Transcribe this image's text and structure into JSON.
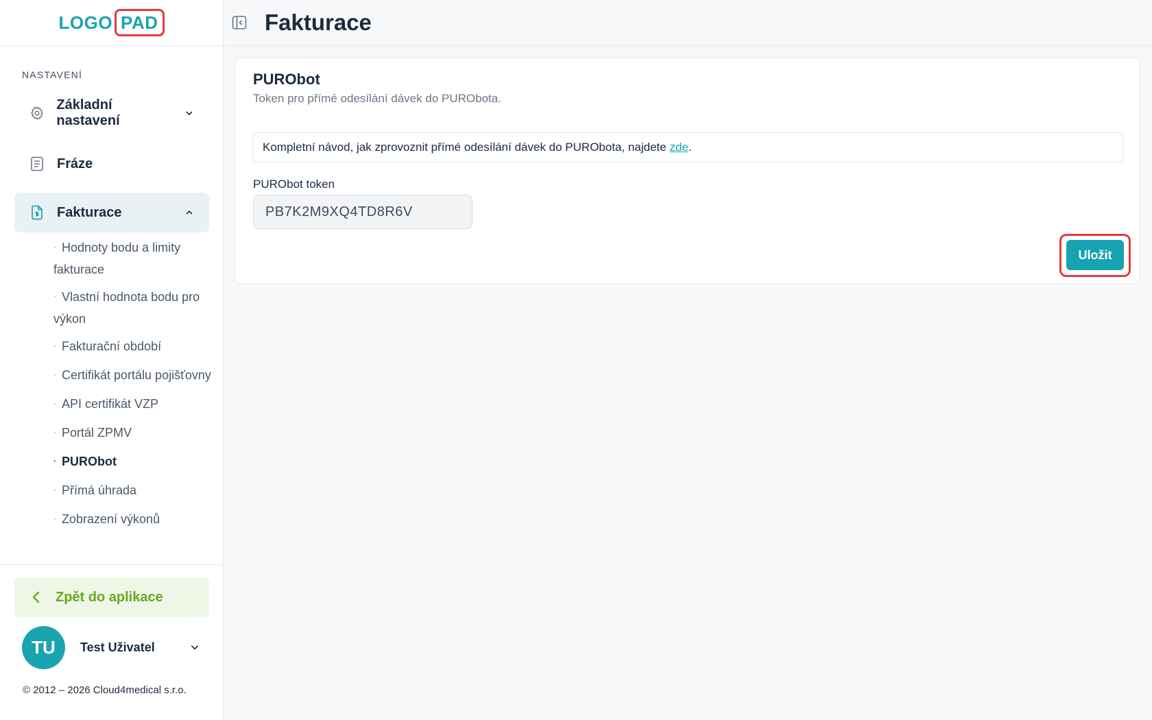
{
  "logo": {
    "word": "LOGO",
    "pad": "PAD"
  },
  "sidebar": {
    "section_label": "NASTAVENÍ",
    "items": [
      {
        "label": "Základní nastavení",
        "icon": "gear-icon",
        "chevron": "chevron-down-icon"
      },
      {
        "label": "Fráze",
        "icon": "document-icon"
      },
      {
        "label": "Fakturace",
        "icon": "invoice-icon",
        "chevron": "chevron-up-icon",
        "active": true
      }
    ],
    "sub_items": [
      {
        "label": "Hodnoty bodu a limity fakturace"
      },
      {
        "label": "Vlastní hodnota bodu pro výkon"
      },
      {
        "label": "Fakturační období"
      },
      {
        "label": "Certifikát portálu pojišťovny"
      },
      {
        "label": "API certifikát VZP"
      },
      {
        "label": "Portál ZPMV"
      },
      {
        "label": "PURObot",
        "current": true
      },
      {
        "label": "Přímá úhrada"
      },
      {
        "label": "Zobrazení výkonů"
      }
    ],
    "back_button": "Zpět do aplikace",
    "user": {
      "initials": "TU",
      "name": "Test Uživatel"
    },
    "copyright": "© 2012 – 2026 Cloud4medical s.r.o."
  },
  "header": {
    "title": "Fakturace"
  },
  "card": {
    "title": "PURObot",
    "subtitle": "Token pro přímé odesílání dávek do PURObota.",
    "info_text": "Kompletní návod, jak zprovoznit přímé odesílání dávek do PURObota, najdete ",
    "info_link": "zde",
    "info_end": ".",
    "field_label": "PURObot token",
    "token_value": "PB7K2M9XQ4TD8R6V",
    "save_label": "Uložit"
  },
  "colors": {
    "accent": "#1aa4b0",
    "back_green": "#6aa820",
    "highlight_red": "#e23b3b"
  }
}
